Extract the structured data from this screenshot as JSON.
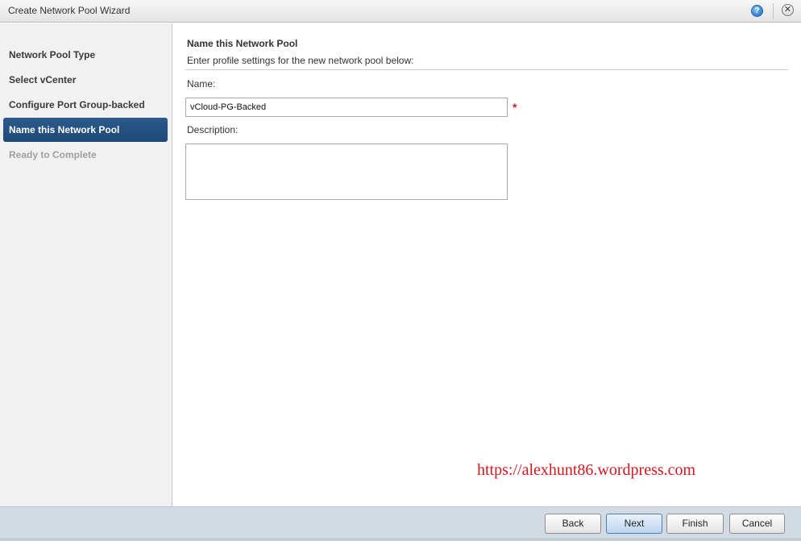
{
  "window": {
    "title": "Create Network Pool Wizard",
    "help_glyph": "?",
    "close_glyph": "✕"
  },
  "steps": [
    {
      "label": "Network Pool Type",
      "state": "done"
    },
    {
      "label": "Select vCenter",
      "state": "done"
    },
    {
      "label": "Configure Port Group-backed Pool",
      "state": "done"
    },
    {
      "label": "Name this Network Pool",
      "state": "active"
    },
    {
      "label": "Ready to Complete",
      "state": "disabled"
    }
  ],
  "content": {
    "heading": "Name this Network Pool",
    "subheading": "Enter profile settings for the new network pool below:",
    "name_label": "Name:",
    "name_value": "vCloud-PG-Backed",
    "required_mark": "*",
    "description_label": "Description:",
    "description_value": ""
  },
  "watermark": "https://alexhunt86.wordpress.com",
  "buttons": {
    "back": "Back",
    "next": "Next",
    "finish": "Finish",
    "cancel": "Cancel"
  },
  "colors": {
    "active_step": "#234f80",
    "required": "#c0202a",
    "watermark": "#d4171f"
  }
}
